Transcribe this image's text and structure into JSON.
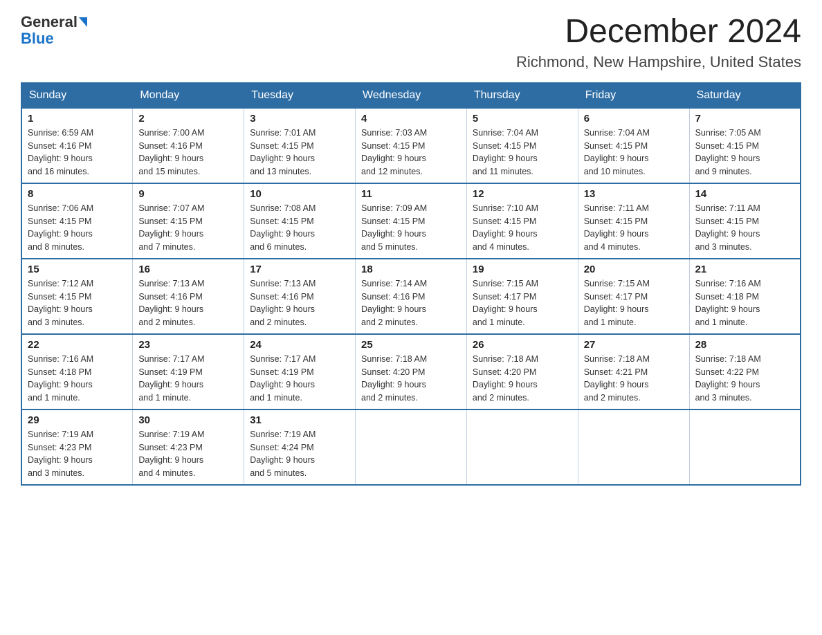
{
  "header": {
    "logo_line1": "General",
    "logo_line2": "Blue",
    "title": "December 2024",
    "subtitle": "Richmond, New Hampshire, United States"
  },
  "weekdays": [
    "Sunday",
    "Monday",
    "Tuesday",
    "Wednesday",
    "Thursday",
    "Friday",
    "Saturday"
  ],
  "weeks": [
    [
      {
        "day": "1",
        "sunrise": "6:59 AM",
        "sunset": "4:16 PM",
        "daylight": "9 hours and 16 minutes."
      },
      {
        "day": "2",
        "sunrise": "7:00 AM",
        "sunset": "4:16 PM",
        "daylight": "9 hours and 15 minutes."
      },
      {
        "day": "3",
        "sunrise": "7:01 AM",
        "sunset": "4:15 PM",
        "daylight": "9 hours and 13 minutes."
      },
      {
        "day": "4",
        "sunrise": "7:03 AM",
        "sunset": "4:15 PM",
        "daylight": "9 hours and 12 minutes."
      },
      {
        "day": "5",
        "sunrise": "7:04 AM",
        "sunset": "4:15 PM",
        "daylight": "9 hours and 11 minutes."
      },
      {
        "day": "6",
        "sunrise": "7:04 AM",
        "sunset": "4:15 PM",
        "daylight": "9 hours and 10 minutes."
      },
      {
        "day": "7",
        "sunrise": "7:05 AM",
        "sunset": "4:15 PM",
        "daylight": "9 hours and 9 minutes."
      }
    ],
    [
      {
        "day": "8",
        "sunrise": "7:06 AM",
        "sunset": "4:15 PM",
        "daylight": "9 hours and 8 minutes."
      },
      {
        "day": "9",
        "sunrise": "7:07 AM",
        "sunset": "4:15 PM",
        "daylight": "9 hours and 7 minutes."
      },
      {
        "day": "10",
        "sunrise": "7:08 AM",
        "sunset": "4:15 PM",
        "daylight": "9 hours and 6 minutes."
      },
      {
        "day": "11",
        "sunrise": "7:09 AM",
        "sunset": "4:15 PM",
        "daylight": "9 hours and 5 minutes."
      },
      {
        "day": "12",
        "sunrise": "7:10 AM",
        "sunset": "4:15 PM",
        "daylight": "9 hours and 4 minutes."
      },
      {
        "day": "13",
        "sunrise": "7:11 AM",
        "sunset": "4:15 PM",
        "daylight": "9 hours and 4 minutes."
      },
      {
        "day": "14",
        "sunrise": "7:11 AM",
        "sunset": "4:15 PM",
        "daylight": "9 hours and 3 minutes."
      }
    ],
    [
      {
        "day": "15",
        "sunrise": "7:12 AM",
        "sunset": "4:15 PM",
        "daylight": "9 hours and 3 minutes."
      },
      {
        "day": "16",
        "sunrise": "7:13 AM",
        "sunset": "4:16 PM",
        "daylight": "9 hours and 2 minutes."
      },
      {
        "day": "17",
        "sunrise": "7:13 AM",
        "sunset": "4:16 PM",
        "daylight": "9 hours and 2 minutes."
      },
      {
        "day": "18",
        "sunrise": "7:14 AM",
        "sunset": "4:16 PM",
        "daylight": "9 hours and 2 minutes."
      },
      {
        "day": "19",
        "sunrise": "7:15 AM",
        "sunset": "4:17 PM",
        "daylight": "9 hours and 1 minute."
      },
      {
        "day": "20",
        "sunrise": "7:15 AM",
        "sunset": "4:17 PM",
        "daylight": "9 hours and 1 minute."
      },
      {
        "day": "21",
        "sunrise": "7:16 AM",
        "sunset": "4:18 PM",
        "daylight": "9 hours and 1 minute."
      }
    ],
    [
      {
        "day": "22",
        "sunrise": "7:16 AM",
        "sunset": "4:18 PM",
        "daylight": "9 hours and 1 minute."
      },
      {
        "day": "23",
        "sunrise": "7:17 AM",
        "sunset": "4:19 PM",
        "daylight": "9 hours and 1 minute."
      },
      {
        "day": "24",
        "sunrise": "7:17 AM",
        "sunset": "4:19 PM",
        "daylight": "9 hours and 1 minute."
      },
      {
        "day": "25",
        "sunrise": "7:18 AM",
        "sunset": "4:20 PM",
        "daylight": "9 hours and 2 minutes."
      },
      {
        "day": "26",
        "sunrise": "7:18 AM",
        "sunset": "4:20 PM",
        "daylight": "9 hours and 2 minutes."
      },
      {
        "day": "27",
        "sunrise": "7:18 AM",
        "sunset": "4:21 PM",
        "daylight": "9 hours and 2 minutes."
      },
      {
        "day": "28",
        "sunrise": "7:18 AM",
        "sunset": "4:22 PM",
        "daylight": "9 hours and 3 minutes."
      }
    ],
    [
      {
        "day": "29",
        "sunrise": "7:19 AM",
        "sunset": "4:23 PM",
        "daylight": "9 hours and 3 minutes."
      },
      {
        "day": "30",
        "sunrise": "7:19 AM",
        "sunset": "4:23 PM",
        "daylight": "9 hours and 4 minutes."
      },
      {
        "day": "31",
        "sunrise": "7:19 AM",
        "sunset": "4:24 PM",
        "daylight": "9 hours and 5 minutes."
      },
      null,
      null,
      null,
      null
    ]
  ],
  "labels": {
    "sunrise": "Sunrise:",
    "sunset": "Sunset:",
    "daylight": "Daylight:"
  }
}
